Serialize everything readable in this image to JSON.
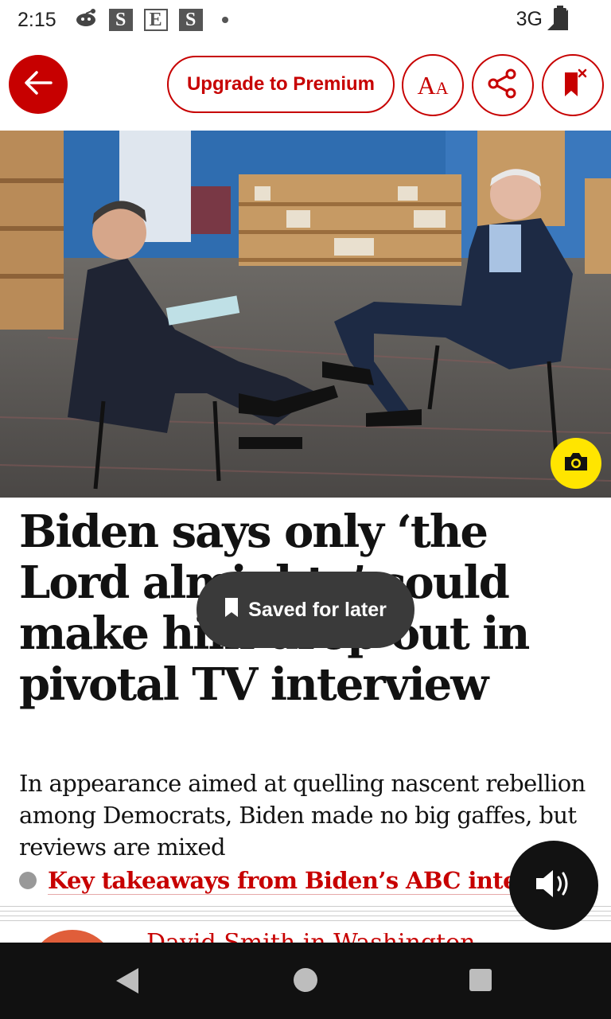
{
  "status_bar": {
    "time": "2:15",
    "icons": [
      "reddit-icon",
      "s-badge-icon",
      "e-badge-icon",
      "s-badge-icon",
      "dot-icon"
    ],
    "badges": [
      "S",
      "E",
      "S"
    ],
    "network": "3G"
  },
  "toolbar": {
    "back_icon": "arrow-left-icon",
    "premium_label": "Upgrade to Premium",
    "font_label_big": "A",
    "font_label_small": "A",
    "share_icon": "share-icon",
    "save_icon": "bookmark-remove-icon"
  },
  "hero": {
    "camera_icon": "camera-icon"
  },
  "article": {
    "headline": "Biden says only ‘the Lord almighty’ could make him drop out in pivotal TV interview",
    "standfirst": "In appearance aimed at quelling nascent rebellion among Democrats, Biden made no big gaffes, but reviews are mixed",
    "takeaway_link": "Key takeaways from Biden’s ABC interview",
    "byline_peek": "David Smith in Washington"
  },
  "toast": {
    "label": "Saved for later",
    "icon": "bookmark-icon"
  },
  "listen": {
    "icon": "speaker-icon"
  },
  "nav_bar": {
    "icons": [
      "back-triangle-icon",
      "home-circle-icon",
      "recents-square-icon"
    ]
  },
  "colors": {
    "guardian_red": "#c70000",
    "camera_yellow": "#ffe500",
    "toast_bg": "#3a3a3a",
    "nav_bg": "#111111"
  }
}
